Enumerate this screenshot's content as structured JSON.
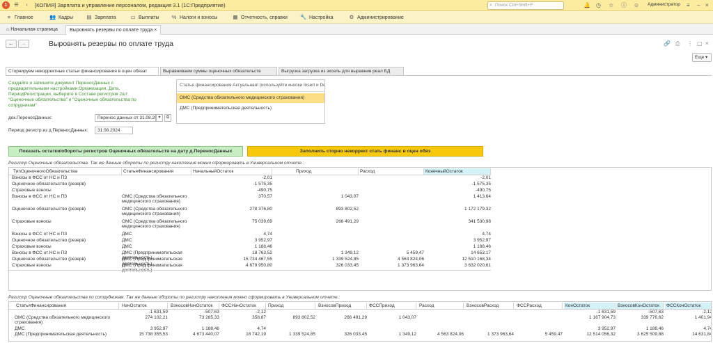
{
  "titlebar": {
    "title": "[КОПИЯ] Зарплата и управление персоналом, редакция 3.1  (1С:Предприятие)",
    "search_placeholder": "Поиск Ctrl+Shift+F",
    "user": "Администратор"
  },
  "menu": [
    "Главное",
    "Кадры",
    "Зарплата",
    "Выплаты",
    "Налоги и взносы",
    "Отчетность, справки",
    "Настройка",
    "Администрирование"
  ],
  "window_tabs": [
    "Начальная страница",
    "Выровнять резервы по оплате труда"
  ],
  "page": {
    "title": "Выровнять резервы по оплате труда",
    "more": "Еще"
  },
  "form_tabs": [
    "Сторнируем некорректные статьи финансирования в оцен обязат",
    "Выравниваем суммы оценочных обязательств",
    "Выгрузка загрузка из эксель для выравнив реал БД"
  ],
  "hint": "Создайте и запишите документ ПереносДанных с предварительными настройками:Организация, Дата, ПериодРегистрации, выберите в Составе регистров 2шт \"Оценочные обязательства\" и \"Оценочные обязательства по сотрудникам\"",
  "doc_field": {
    "label": "док.ПереносДанных:",
    "value": "Перенос данных  от 31.08.2024"
  },
  "period_field": {
    "label": "Период регистр.из д.ПереносДанных:",
    "value": "31.08.2024"
  },
  "fin_list": {
    "header": "Статья финансирования Актуальная! (используйте кнопки Insert и Delete)",
    "items": [
      "ОМС (Средства обязательного медицинского страхования)",
      "ДМС (Предпринимательская деятельность)"
    ]
  },
  "buttons": {
    "show": "Показать остатки/обороты регистров Оценочных обязательств на дату д.ПереносДанных",
    "fill": "Заполнить сторно некоррект стать финанс в оцен обяз"
  },
  "table1": {
    "caption": "Регистр Оценочные обязательства. Так же данные обороты по регистру накопления можно сформировать в Универсальном отчете.:",
    "columns": [
      "ТипОценочногоОбязательства",
      "СтатьяФинансирования",
      "НачальныйОстаток",
      "Приход",
      "Расход",
      "КонечныйОстаток"
    ],
    "rows": [
      [
        "Взносы в ФСС от НС и ПЗ",
        "",
        "-2,01",
        "",
        "",
        "-2,01"
      ],
      [
        "Оценочное обязательство (резерв)",
        "",
        "-1 575,35",
        "",
        "",
        "-1 575,35"
      ],
      [
        "Страховые взносы",
        "",
        "-490,75",
        "",
        "",
        "-490,75"
      ],
      [
        "Взносы в ФСС от НС и ПЗ",
        "ОМС (Средства обязательного медицинского страхования)",
        "370,57",
        "1 043,07",
        "",
        "1 413,64"
      ],
      [
        "Оценочное обязательство (резерв)",
        "ОМС (Средства обязательного медицинского страхования)",
        "278 376,80",
        "893 802,52",
        "",
        "1 172 179,32"
      ],
      [
        "Страховые взносы",
        "ОМС (Средства обязательного медицинского страхования)",
        "75 039,69",
        "266 491,29",
        "",
        "341 530,98"
      ],
      [
        "Взносы в ФСС от НС и ПЗ",
        "ДМС",
        "4,74",
        "",
        "",
        "4,74"
      ],
      [
        "Оценочное обязательство (резерв)",
        "ДМС",
        "3 952,97",
        "",
        "",
        "3 952,97"
      ],
      [
        "Страховые взносы",
        "ДМС",
        "1 188,46",
        "",
        "",
        "1 188,46"
      ],
      [
        "Взносы в ФСС от НС и ПЗ",
        "ДМС (Предпринимательская деятельность)",
        "18 763,52",
        "1 349,12",
        "5 459,47",
        "14 653,17"
      ],
      [
        "Оценочное обязательство (резерв)",
        "ДМС (Предпринимательская деятельность)",
        "15 734 467,55",
        "1 339 524,85",
        "4 563 824,06",
        "12 510 168,34"
      ],
      [
        "Страховые взносы",
        "ДМС (Предпринимательская деятельность)",
        "4 679 950,80",
        "326 033,45",
        "1 373 963,64",
        "3 632 020,61"
      ]
    ]
  },
  "table2": {
    "caption": "Регистр Оценочные обязательства по сотрудникам. Так же данные обороты по регистру накопления можно сформировать в Универсальном отчете.:",
    "columns": [
      "СтатьяФинансирования",
      "НачОстаток",
      "ВзносовНачОстаток",
      "ФССНачОстаток",
      "Приход",
      "ВзносовПриход",
      "ФССПриход",
      "Расход",
      "ВзносовРасход",
      "ФССРасход",
      "КонОстаток",
      "ВзносовКонОстаток",
      "ФССКонОстаток"
    ],
    "rows": [
      [
        "",
        "-1 631,59",
        "-507,63",
        "-2,12",
        "",
        "",
        "",
        "",
        "",
        "",
        "-1 631,59",
        "-507,63",
        "-2,12"
      ],
      [
        "ОМС (Средства обязательного медицинского страхования)",
        "274 102,21",
        "73 285,33",
        "358,87",
        "893 802,52",
        "266 491,29",
        "1 043,07",
        "",
        "",
        "",
        "1 167 904,73",
        "339 776,62",
        "1 401,94"
      ],
      [
        "ДМС",
        "3 952,97",
        "1 188,46",
        "4,74",
        "",
        "",
        "",
        "",
        "",
        "",
        "3 952,97",
        "1 188,46",
        "4,74"
      ],
      [
        "ДМС (Предпринимательская деятельность)",
        "15 738 355,53",
        "4 673 440,07",
        "18 742,19",
        "1 339 524,85",
        "326 033,45",
        "1 349,12",
        "4 563 824,06",
        "1 373 963,64",
        "5 459,47",
        "12 514 056,32",
        "3 625 509,88",
        "14 631,84"
      ]
    ]
  }
}
